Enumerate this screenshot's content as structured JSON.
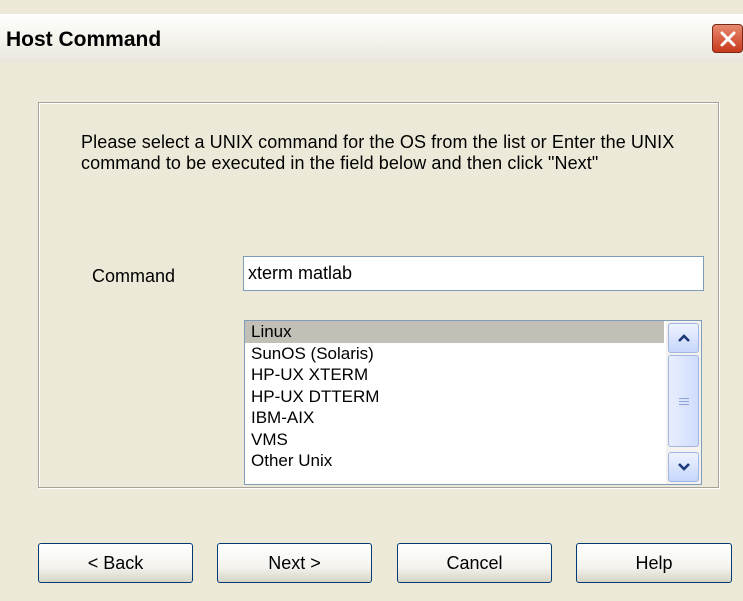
{
  "window": {
    "title": "Host Command",
    "close_icon": "close-icon"
  },
  "instructions": "Please select a UNIX command for the OS from the list  or Enter the UNIX command to be executed in the field below and then click \"Next\"",
  "command": {
    "label": "Command",
    "value": "xterm matlab"
  },
  "os_list": {
    "items": [
      "Linux",
      "SunOS (Solaris)",
      "HP-UX XTERM",
      "HP-UX DTTERM",
      "IBM-AIX",
      "VMS",
      "Other Unix"
    ],
    "selected": "Linux"
  },
  "buttons": {
    "back": "< Back",
    "next": "Next >",
    "cancel": "Cancel",
    "help": "Help"
  },
  "colors": {
    "dialog_bg": "#ece9d8",
    "selection": "#c1bfb6",
    "close_button": "#c8381a"
  }
}
